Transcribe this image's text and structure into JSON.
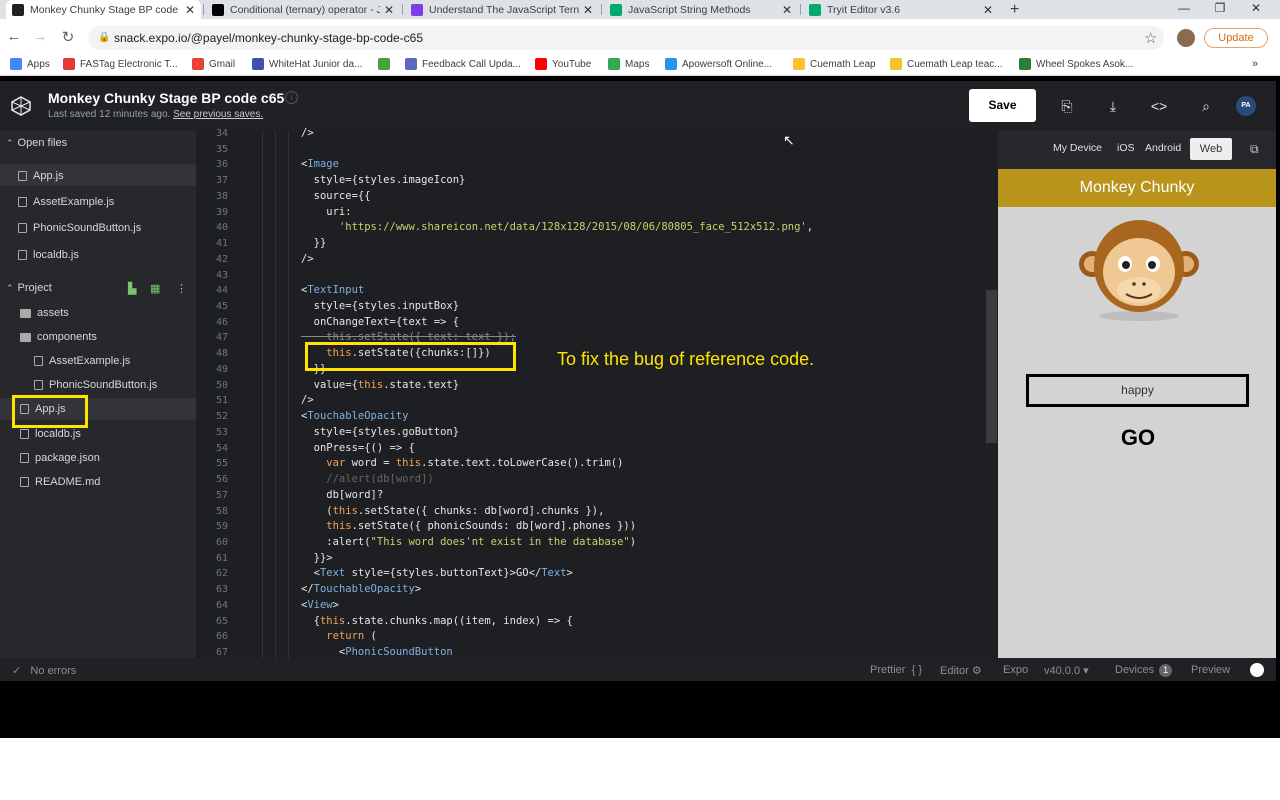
{
  "browser": {
    "tabs": [
      {
        "title": "Monkey Chunky Stage BP code c",
        "icon": "expo-icon",
        "color": "#222222"
      },
      {
        "title": "Conditional (ternary) operator - J",
        "icon": "mdn-icon",
        "color": "#000000"
      },
      {
        "title": "Understand The JavaScript Terna",
        "icon": "blog-icon",
        "color": "#7b3fe4"
      },
      {
        "title": "JavaScript String Methods",
        "icon": "w3schools-icon",
        "color": "#04aa6d"
      },
      {
        "title": "Tryit Editor v3.6",
        "icon": "w3schools-icon",
        "color": "#04aa6d"
      }
    ],
    "url": "snack.expo.io/@payel/monkey-chunky-stage-bp-code-c65",
    "update_label": "Update",
    "bookmarks": [
      {
        "label": "Apps",
        "color": "#4285f4"
      },
      {
        "label": "FASTag Electronic T...",
        "color": "#e53935"
      },
      {
        "label": "Gmail",
        "color": "#ea4335"
      },
      {
        "label": "WhiteHat Junior da...",
        "color": "#3f51b5"
      },
      {
        "label": "",
        "color": "#43a047"
      },
      {
        "label": "Feedback Call Upda...",
        "color": "#5c6bc0"
      },
      {
        "label": "YouTube",
        "color": "#ff0000"
      },
      {
        "label": "Maps",
        "color": "#34a853"
      },
      {
        "label": "Apowersoft Online...",
        "color": "#2196f3"
      },
      {
        "label": "Cuemath Leap",
        "color": "#fbc02d"
      },
      {
        "label": "Cuemath Leap teac...",
        "color": "#fbc02d"
      },
      {
        "label": "Wheel Spokes Asok...",
        "color": "#2e7d32"
      }
    ]
  },
  "project": {
    "title": "Monkey Chunky Stage  BP code c65",
    "last_saved": "Last saved 12 minutes ago.",
    "see_previous": "See previous saves.",
    "save_label": "Save",
    "avatar_initials": "PA"
  },
  "sidebar": {
    "open_files_label": "Open files",
    "open_files": [
      "App.js",
      "AssetExample.js",
      "PhonicSoundButton.js",
      "localdb.js"
    ],
    "project_label": "Project",
    "tree": [
      {
        "label": "assets",
        "type": "folder"
      },
      {
        "label": "components",
        "type": "folder"
      },
      {
        "label": "AssetExample.js",
        "type": "file"
      },
      {
        "label": "PhonicSoundButton.js",
        "type": "file"
      },
      {
        "label": "App.js",
        "type": "file"
      },
      {
        "label": "localdb.js",
        "type": "file"
      },
      {
        "label": "package.json",
        "type": "file"
      },
      {
        "label": "README.md",
        "type": "file"
      }
    ]
  },
  "editor": {
    "line_numbers": [
      "34",
      "35",
      "36",
      "37",
      "38",
      "39",
      "40",
      "41",
      "42",
      "43",
      "44",
      "45",
      "46",
      "47",
      "48",
      "49",
      "50",
      "51",
      "52",
      "53",
      "54",
      "55",
      "56",
      "57",
      "58",
      "59",
      "60",
      "61",
      "62",
      "63",
      "64",
      "65",
      "66",
      "67"
    ],
    "lines": [
      "/>",
      "",
      "<Image",
      "  style={styles.imageIcon}",
      "  source={{",
      "    uri:",
      "      'https://www.shareicon.net/data/128x128/2015/08/06/80805_face_512x512.png',",
      "  }}",
      "/>",
      "",
      "<TextInput",
      "  style={styles.inputBox}",
      "  onChangeText={text => {",
      "    this.setState({ text: text });",
      "    this.setState({chunks:[]})",
      "  }}",
      "  value={this.state.text}",
      "/>",
      "<TouchableOpacity",
      "  style={styles.goButton}",
      "  onPress={() => {",
      "    var word = this.state.text.toLowerCase().trim()",
      "    //alert(db[word])",
      "    db[word]?",
      "    (this.setState({ chunks: db[word].chunks }),",
      "    this.setState({ phonicSounds: db[word].phones }))",
      "    :alert(\"This word does'nt exist in the database\")",
      "  }}>",
      "  <Text style={styles.buttonText}>GO</Text>",
      "</TouchableOpacity>",
      "<View>",
      "  {this.state.chunks.map((item, index) => {",
      "    return (",
      "      <PhonicSoundButton"
    ]
  },
  "annotation": {
    "text": "To fix the bug of reference code.",
    "color": "#ffe400"
  },
  "preview": {
    "device_tabs": [
      "My Device",
      "iOS",
      "Android",
      "Web"
    ],
    "active_tab": "Web",
    "app_title": "Monkey Chunky",
    "app_bar_color": "#b8941b",
    "input_value": "happy",
    "go_label": "GO"
  },
  "status": {
    "errors": "No errors",
    "prettier": "Prettier",
    "braces": "{ }",
    "editor": "Editor",
    "expo": "Expo",
    "version": "v40.0.0",
    "devices": "Devices",
    "devices_count": "1",
    "preview": "Preview"
  }
}
